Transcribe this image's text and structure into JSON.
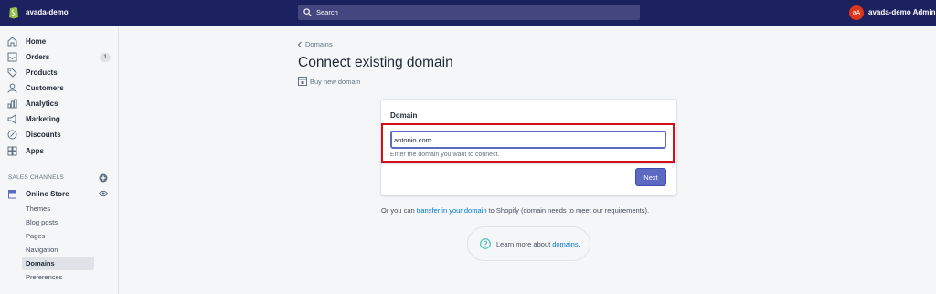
{
  "topbar": {
    "store_name": "avada-demo",
    "search_placeholder": "Search",
    "avatar_initials": "aA",
    "user_name": "avada-demo Admin"
  },
  "sidebar": {
    "items": [
      {
        "label": "Home",
        "icon": "home-icon"
      },
      {
        "label": "Orders",
        "icon": "orders-icon",
        "badge": "1"
      },
      {
        "label": "Products",
        "icon": "tag-icon"
      },
      {
        "label": "Customers",
        "icon": "person-icon"
      },
      {
        "label": "Analytics",
        "icon": "bar-chart-icon"
      },
      {
        "label": "Marketing",
        "icon": "megaphone-icon"
      },
      {
        "label": "Discounts",
        "icon": "discount-icon"
      },
      {
        "label": "Apps",
        "icon": "apps-icon"
      }
    ],
    "sales_channels_title": "SALES CHANNELS",
    "online_store_label": "Online Store",
    "sub_items": [
      "Themes",
      "Blog posts",
      "Pages",
      "Navigation",
      "Domains",
      "Preferences"
    ],
    "active_sub_item": "Domains"
  },
  "main": {
    "breadcrumb": "Domains",
    "title": "Connect existing domain",
    "buy_link": "Buy new domain",
    "card": {
      "title": "Domain",
      "input_value": "antonio.com",
      "help_text": "Enter the domain you want to connect.",
      "next_label": "Next"
    },
    "transfer": {
      "prefix": "Or you can ",
      "link": "transfer in your domain",
      "suffix": " to Shopify (domain needs to meet our requirements)."
    },
    "learn_more": {
      "prefix": "Learn more about ",
      "link": "domains",
      "suffix": "."
    }
  },
  "colors": {
    "topbar": "#1c2260",
    "accent": "#5c6ac4",
    "link": "#007ace",
    "highlight": "#d0111b"
  }
}
